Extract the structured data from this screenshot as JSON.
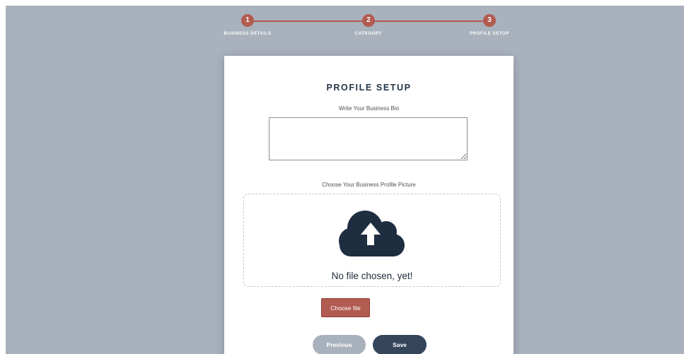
{
  "stepper": {
    "steps": [
      {
        "number": "1",
        "label": "BUSINESS DETAILS"
      },
      {
        "number": "2",
        "label": "CATEGORY"
      },
      {
        "number": "3",
        "label": "PROFILE SETUP"
      }
    ],
    "color": "#b25b50"
  },
  "card": {
    "title": "PROFILE SETUP",
    "bio_label": "Write Your Business Bio",
    "bio_value": "",
    "picture_label": "Choose Your Business Profile Picture",
    "dropzone_text": "No file chosen, yet!",
    "upload_icon": "cloud-upload-icon",
    "choose_file_label": "Choose file",
    "previous_label": "Previous",
    "save_label": "Save"
  },
  "colors": {
    "background": "#a9b1bc",
    "accent": "#b25b50",
    "primary_dark": "#35465b",
    "icon": "#1e2d40"
  }
}
